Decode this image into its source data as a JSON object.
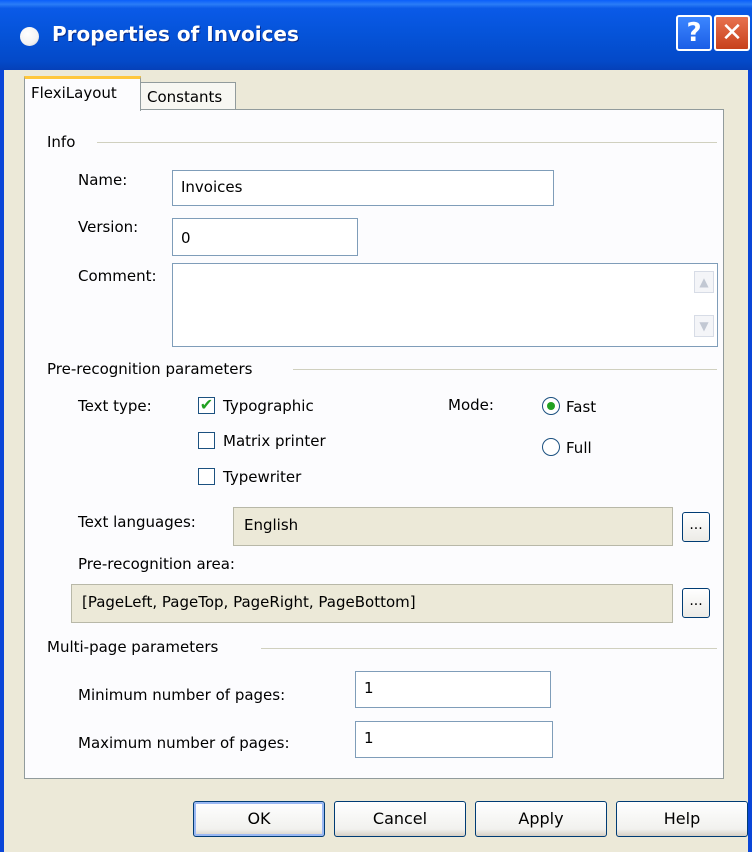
{
  "window": {
    "title": "Properties of Invoices"
  },
  "tabs": [
    "FlexiLayout",
    "Constants"
  ],
  "info": {
    "heading": "Info",
    "name_label": "Name:",
    "name_value": "Invoices",
    "version_label": "Version:",
    "version_value": "0",
    "comment_label": "Comment:",
    "comment_value": ""
  },
  "prerecog": {
    "heading": "Pre-recognition parameters",
    "text_type_label": "Text type:",
    "checkboxes": [
      {
        "label": "Typographic",
        "checked": true
      },
      {
        "label": "Matrix printer",
        "checked": false
      },
      {
        "label": "Typewriter",
        "checked": false
      }
    ],
    "mode_label": "Mode:",
    "modes": [
      {
        "label": "Fast",
        "selected": true
      },
      {
        "label": "Full",
        "selected": false
      }
    ],
    "languages_label": "Text languages:",
    "languages_value": "English",
    "area_label": "Pre-recognition area:",
    "area_value": "[PageLeft, PageTop, PageRight, PageBottom]",
    "browse_label": "..."
  },
  "multipage": {
    "heading": "Multi-page parameters",
    "min_label": "Minimum number of pages:",
    "min_value": "1",
    "max_label": "Maximum number of pages:",
    "max_value": "1"
  },
  "buttons": {
    "ok": "OK",
    "cancel": "Cancel",
    "apply": "Apply",
    "help": "Help"
  },
  "titlebar_buttons": {
    "help": "?",
    "close": "✕"
  },
  "colors": {
    "titlebar": "#0553d8",
    "check_accent": "#21a121",
    "dialog_bg": "#ece9d8"
  }
}
